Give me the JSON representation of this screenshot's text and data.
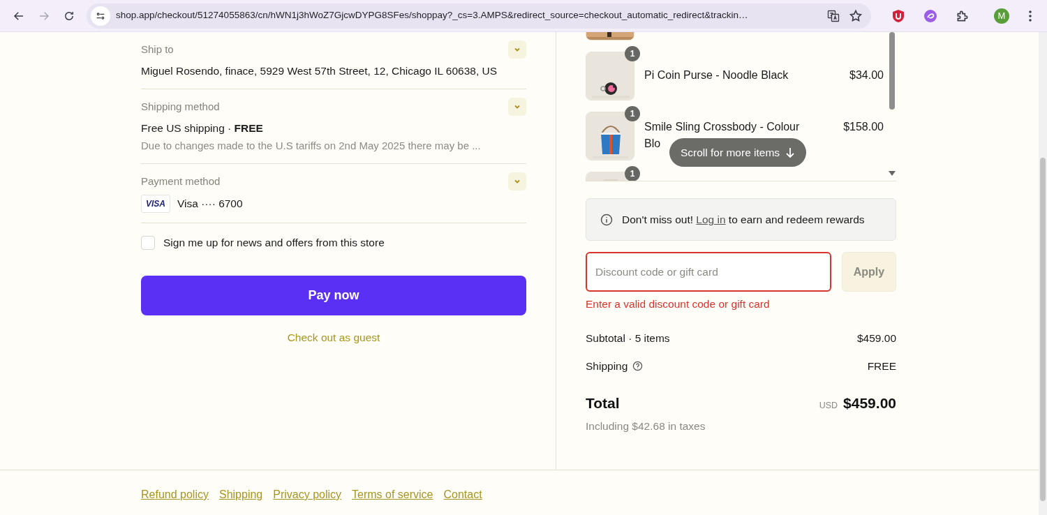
{
  "browser": {
    "url": "shop.app/checkout/51274055863/cn/hWN1j3hWoZ7GjcwDYPG8SFes/shoppay?_cs=3.AMPS&redirect_source=checkout_automatic_redirect&trackin…",
    "forward_enabled": false,
    "profile_initial": "M"
  },
  "sections": [
    {
      "label": "Ship to",
      "lines": [
        "Miguel Rosendo, finace, 5929 West 57th Street, 12, Chicago IL 60638, US"
      ]
    },
    {
      "label": "Shipping method",
      "lines": [
        "Free US shipping · **FREE**"
      ],
      "note": "Due to changes made to the U.S tariffs on 2nd May 2025 there may be ..."
    },
    {
      "label": "Payment method",
      "card_brand": "VISA",
      "lines": [
        "Visa ···· 6700"
      ]
    }
  ],
  "newsletter": {
    "label": "Sign me up for news and offers from this store",
    "checked": false
  },
  "pay_button": "Pay now",
  "guest_link": "Check out as guest",
  "footer_links": [
    "Refund policy",
    "Shipping",
    "Privacy policy",
    "Terms of service",
    "Contact"
  ],
  "cart_items": [
    {
      "kind": "top-cut"
    },
    {
      "kind": "full",
      "quantity": "1",
      "name": "Pi Coin Purse - Noodle Black",
      "price": "$34.00"
    },
    {
      "kind": "full",
      "quantity": "1",
      "name": "Smile Sling Crossbody - Colour Blo",
      "price": "$158.00"
    },
    {
      "kind": "bottom-cut",
      "quantity": "1"
    }
  ],
  "scroll_hint": "Scroll for more items",
  "rewards_notice": {
    "before": "Don't miss out!",
    "link": "Log in",
    "after": "to earn and redeem rewards"
  },
  "discount": {
    "placeholder": "Discount code or gift card",
    "error": "Enter a valid discount code or gift card"
  },
  "apply_button": {
    "label": "Apply",
    "disabled": true
  },
  "summary": [
    {
      "label": "Subtotal · 5 items",
      "value": "$459.00",
      "help": false
    },
    {
      "label": "Shipping",
      "value": "FREE",
      "help": true
    }
  ],
  "total": {
    "label": "Total",
    "currency": "USD",
    "value": "$459.00",
    "taxes": "Including $42.68 in taxes"
  }
}
